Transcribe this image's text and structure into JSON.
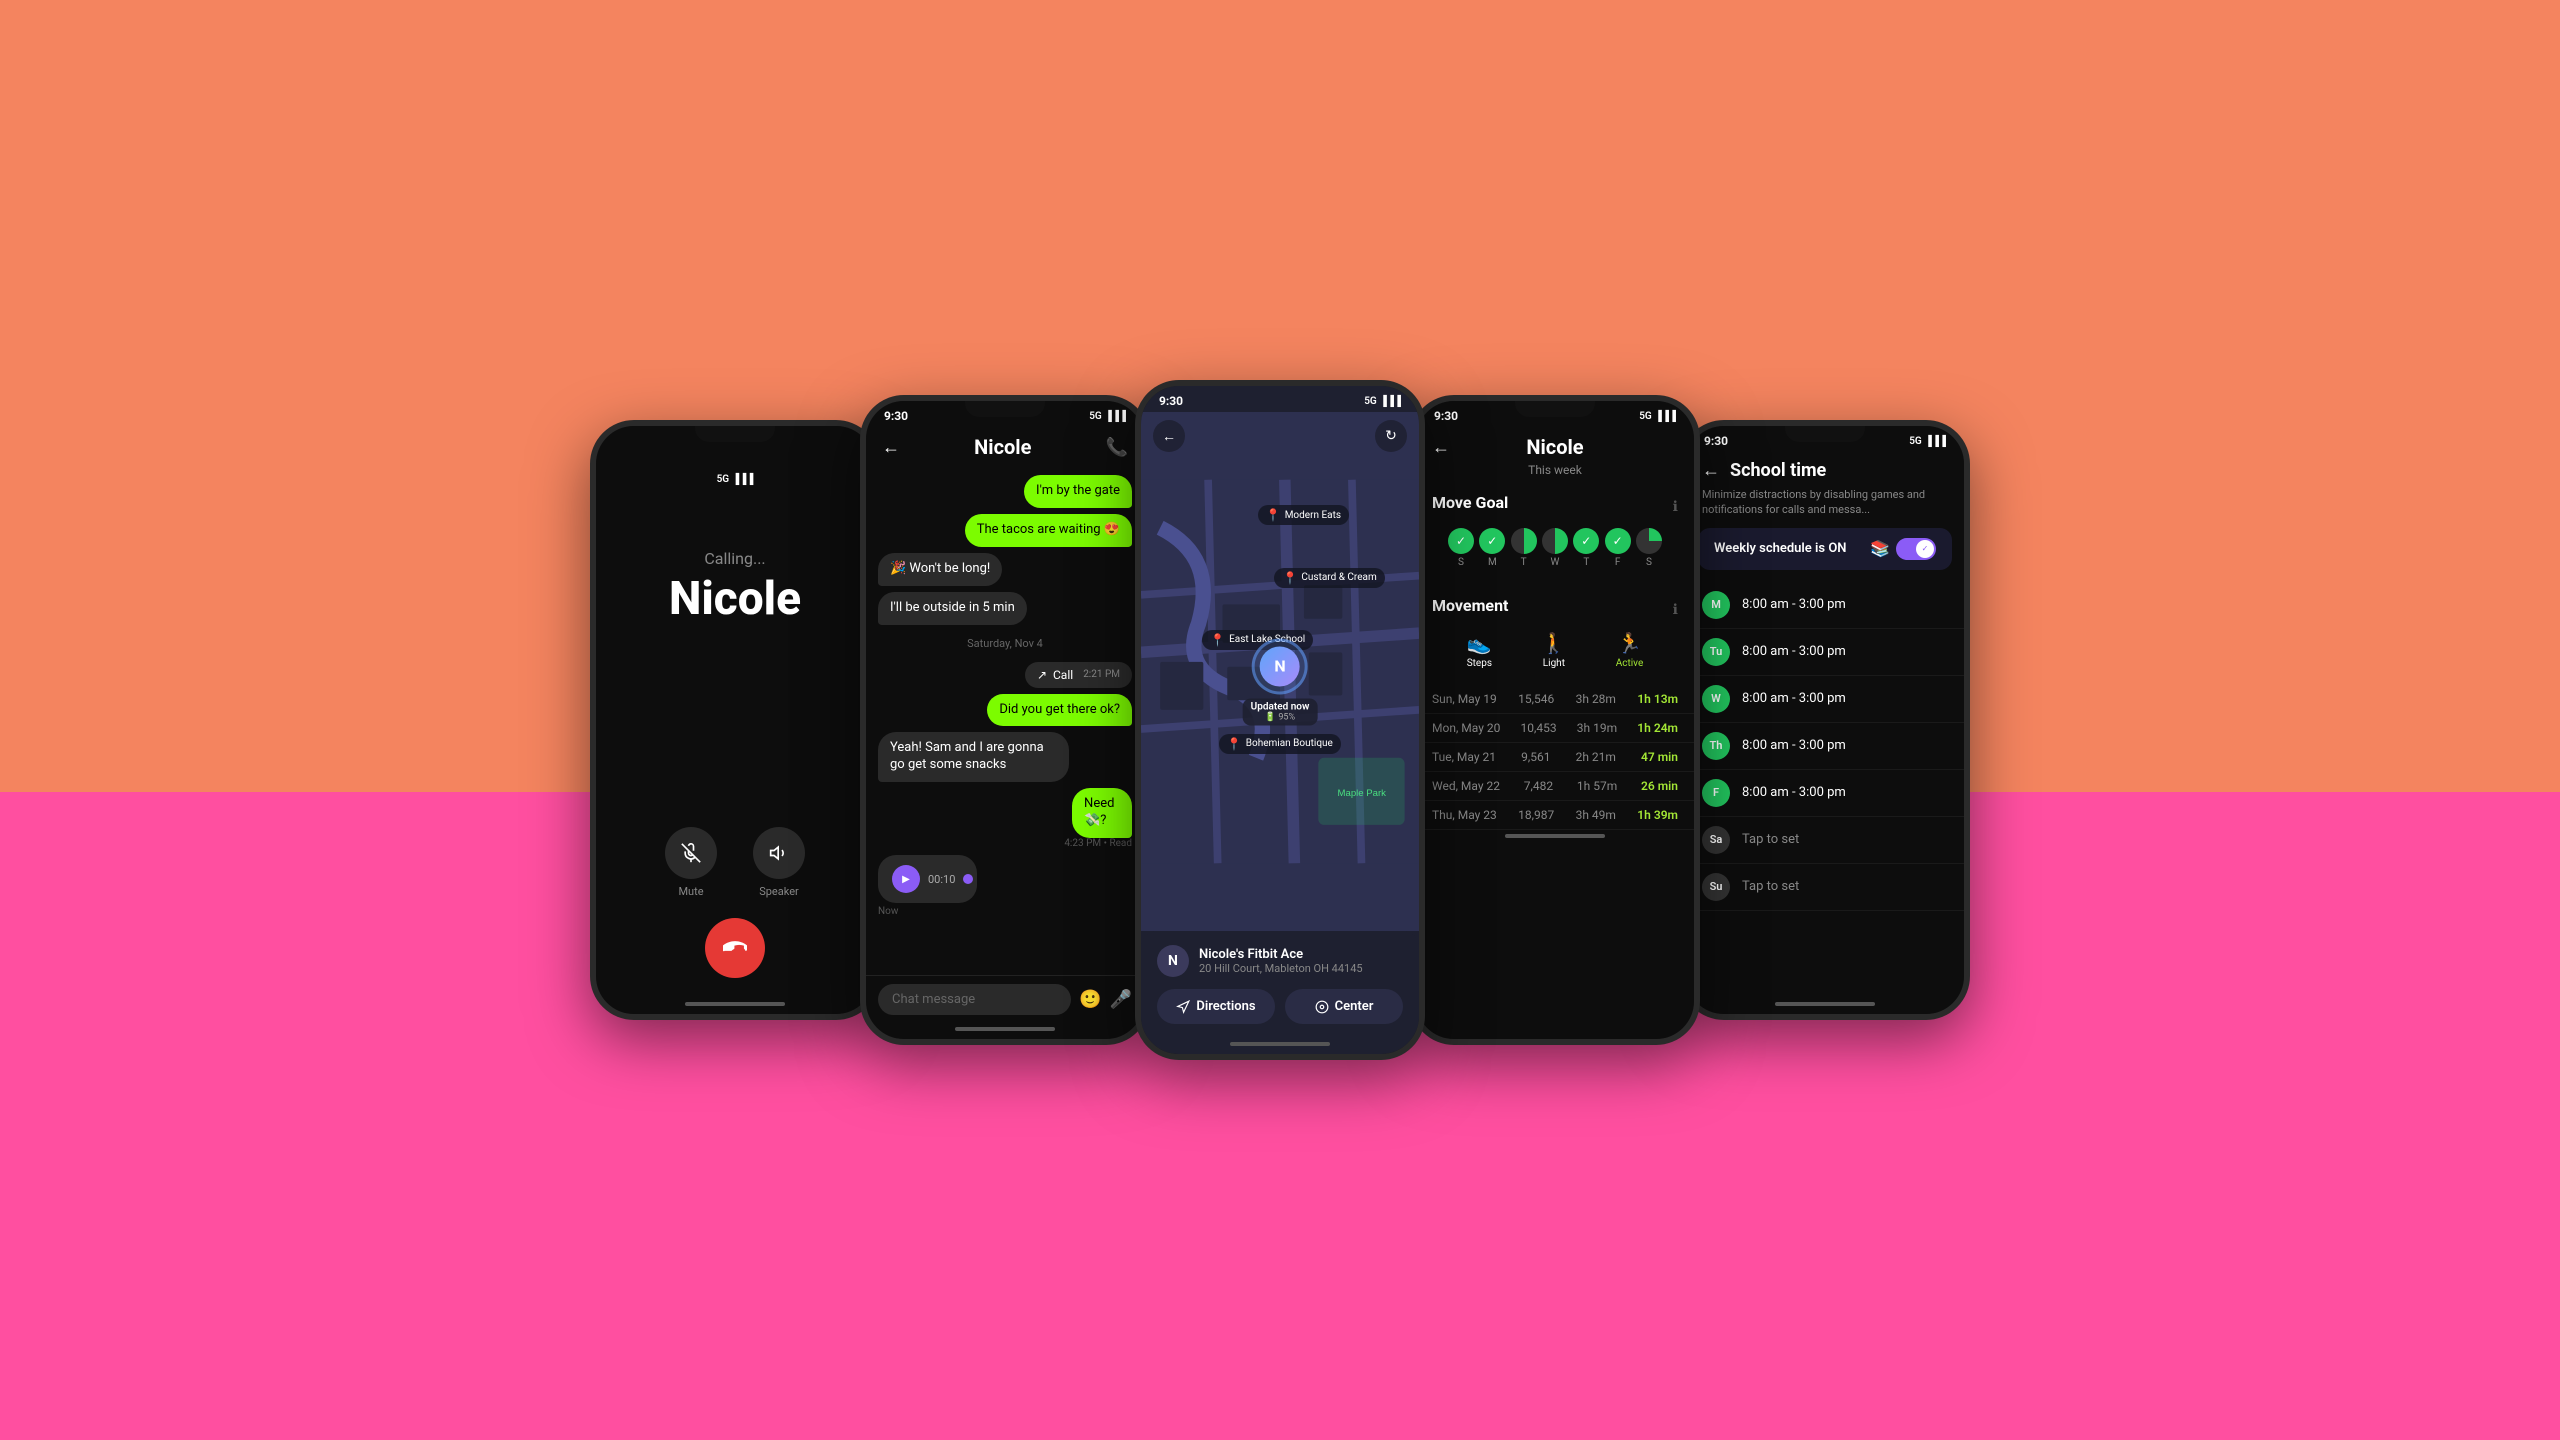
{
  "phones": {
    "phone1": {
      "status_bar": {
        "signal": "5G",
        "battery": "▐▐▐"
      },
      "calling_label": "Calling...",
      "contact_name": "Nicole",
      "controls": {
        "mute": {
          "label": "Mute",
          "icon": "🎤"
        },
        "speaker": {
          "label": "Speaker",
          "icon": "🔊"
        }
      },
      "end_call_icon": "📞"
    },
    "phone2": {
      "status_bar": {
        "time": "9:30",
        "signal": "5G",
        "battery": "▐▐▐"
      },
      "header": {
        "back_icon": "←",
        "title": "Nicole",
        "call_icon": "📞"
      },
      "messages": [
        {
          "type": "sent",
          "text": "I'm by the gate"
        },
        {
          "type": "sent",
          "text": "The tacos are waiting 😍"
        },
        {
          "type": "recv",
          "text": "🎉 Won't be long!"
        },
        {
          "type": "recv",
          "text": "I'll be outside in 5 min"
        },
        {
          "type": "divider",
          "text": "Saturday, Nov 4"
        },
        {
          "type": "call",
          "text": "↗ Call",
          "time": "2:21 PM"
        },
        {
          "type": "sent",
          "text": "Did you get there ok?"
        },
        {
          "type": "recv",
          "text": "Yeah! Sam and I are gonna go get some snacks"
        },
        {
          "type": "sent",
          "text": "Need 💸?",
          "time": "4:23 PM",
          "status": "Read"
        },
        {
          "type": "audio",
          "duration": "00:10",
          "time": "Now"
        }
      ],
      "input_placeholder": "Chat message"
    },
    "phone3": {
      "status_bar": {
        "time": "9:30",
        "signal": "5G",
        "battery": "▐▐▐"
      },
      "map_labels": [
        {
          "icon": "📍",
          "text": "Modern Eats"
        },
        {
          "icon": "📍",
          "text": "Custard & Cream"
        },
        {
          "icon": "📍",
          "text": "East Lake School"
        },
        {
          "icon": "🌳",
          "text": "Maple Park"
        },
        {
          "icon": "📍",
          "text": "Bohemian Boutique"
        }
      ],
      "user_marker": {
        "initial": "N",
        "label": "Updated now",
        "battery": "95%"
      },
      "device_card": {
        "initial": "N",
        "name": "Nicole's Fitbit Ace",
        "address": "20 Hill Court, Mableton OH 44145"
      },
      "buttons": {
        "directions": "Directions",
        "center": "Center"
      }
    },
    "phone4": {
      "status_bar": {
        "time": "9:30",
        "signal": "5G",
        "battery": "▐▐▐"
      },
      "header": {
        "back": "←",
        "title": "Nicole"
      },
      "subtitle": "This week",
      "move_goal": {
        "title": "Move Goal",
        "days": [
          {
            "label": "S",
            "status": "done"
          },
          {
            "label": "M",
            "status": "done"
          },
          {
            "label": "T",
            "status": "half"
          },
          {
            "label": "W",
            "status": "half"
          },
          {
            "label": "T",
            "status": "done"
          },
          {
            "label": "F",
            "status": "done"
          },
          {
            "label": "S",
            "status": "half"
          }
        ]
      },
      "movement": {
        "title": "Movement",
        "columns": [
          "Steps",
          "Light",
          "Active"
        ],
        "rows": [
          {
            "date": "Sun, May 19",
            "steps": "15,546",
            "light": "3h 28m",
            "active": "1h 13m"
          },
          {
            "date": "Mon, May 20",
            "steps": "10,453",
            "light": "3h 19m",
            "active": "1h 24m"
          },
          {
            "date": "Tue, May 21",
            "steps": "9,561",
            "light": "2h 21m",
            "active": "47 min"
          },
          {
            "date": "Wed, May 22",
            "steps": "7,482",
            "light": "1h 57m",
            "active": "26 min"
          },
          {
            "date": "Thu, May 23",
            "steps": "18,987",
            "light": "3h 49m",
            "active": "1h 39m"
          }
        ]
      }
    },
    "phone5": {
      "status_bar": {
        "time": "9:30",
        "signal": "5G",
        "battery": "▐▐▐"
      },
      "header": {
        "back": "←",
        "title": "School time"
      },
      "description": "Minimize distractions by disabling games and notifications for calls and messa...",
      "weekly_schedule": {
        "label": "Weekly schedule is ON",
        "toggle": true
      },
      "schedule_items": [
        {
          "day": "M",
          "time": "8:00 am - 3:00 pm",
          "active": true
        },
        {
          "day": "Tu",
          "time": "8:00 am - 3:00 pm",
          "active": true
        },
        {
          "day": "W",
          "time": "8:00 am - 3:00 pm",
          "active": true
        },
        {
          "day": "Th",
          "time": "8:00 am - 3:00 pm",
          "active": true
        },
        {
          "day": "F",
          "time": "8:00 am - 3:00 pm",
          "active": true
        },
        {
          "day": "Sa",
          "time": "Tap to set",
          "active": false
        },
        {
          "day": "Su",
          "time": "Tap to set",
          "active": false
        }
      ]
    }
  }
}
